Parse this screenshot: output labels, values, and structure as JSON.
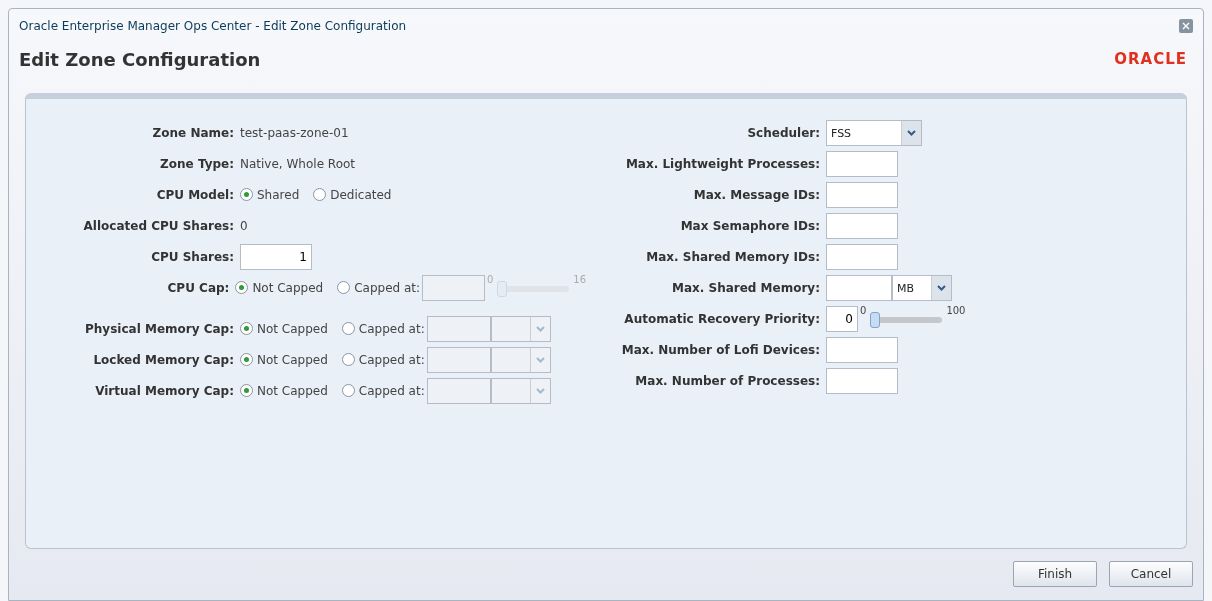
{
  "window": {
    "title": "Oracle Enterprise Manager Ops Center - Edit Zone Configuration"
  },
  "heading": "Edit Zone Configuration",
  "logo": "ORACLE",
  "left_fields": [
    {
      "label": "Zone Name:",
      "kind": "text",
      "value": "test-paas-zone-01"
    },
    {
      "label": "Zone Type:",
      "kind": "text",
      "value": "Native, Whole Root"
    },
    {
      "label": "CPU Model:",
      "kind": "radio",
      "options": [
        {
          "label": "Shared",
          "selected": true
        },
        {
          "label": "Dedicated",
          "selected": false
        }
      ]
    },
    {
      "label": "Allocated CPU Shares:",
      "kind": "text",
      "value": "0"
    },
    {
      "label": "CPU Shares:",
      "kind": "input",
      "value": "1"
    },
    {
      "label": "CPU Cap:",
      "kind": "cap_slider",
      "options": [
        {
          "label": "Not Capped",
          "selected": true
        },
        {
          "label": "Capped at:",
          "selected": false
        }
      ],
      "slider": {
        "min": "0",
        "max": "16",
        "level": 0,
        "disabled": true
      }
    },
    {
      "label": "Physical Memory Cap:",
      "kind": "cap_select",
      "options": [
        {
          "label": "Not Capped",
          "selected": true
        },
        {
          "label": "Capped at:",
          "selected": false
        }
      ]
    },
    {
      "label": "Locked Memory Cap:",
      "kind": "cap_select",
      "options": [
        {
          "label": "Not Capped",
          "selected": true
        },
        {
          "label": "Capped at:",
          "selected": false
        }
      ]
    },
    {
      "label": "Virtual Memory Cap:",
      "kind": "cap_select",
      "options": [
        {
          "label": "Not Capped",
          "selected": true
        },
        {
          "label": "Capped at:",
          "selected": false
        }
      ]
    }
  ],
  "right_fields": [
    {
      "label": "Scheduler:",
      "kind": "select",
      "value": "FSS"
    },
    {
      "label": "Max. Lightweight Processes:",
      "kind": "input"
    },
    {
      "label": "Max. Message IDs:",
      "kind": "input"
    },
    {
      "label": "Max Semaphore IDs:",
      "kind": "input"
    },
    {
      "label": "Max. Shared Memory IDs:",
      "kind": "input"
    },
    {
      "label": "Max. Shared Memory:",
      "kind": "input_unit",
      "unit": "MB"
    },
    {
      "label": "Automatic Recovery Priority:",
      "kind": "input_slider",
      "value": "0",
      "slider": {
        "min": "0",
        "max": "100",
        "level": 0,
        "disabled": false
      }
    },
    {
      "label": "Max. Number of Lofi Devices:",
      "kind": "input"
    },
    {
      "label": "Max. Number of Processes:",
      "kind": "input"
    }
  ],
  "buttons": [
    "Finish",
    "Cancel"
  ]
}
